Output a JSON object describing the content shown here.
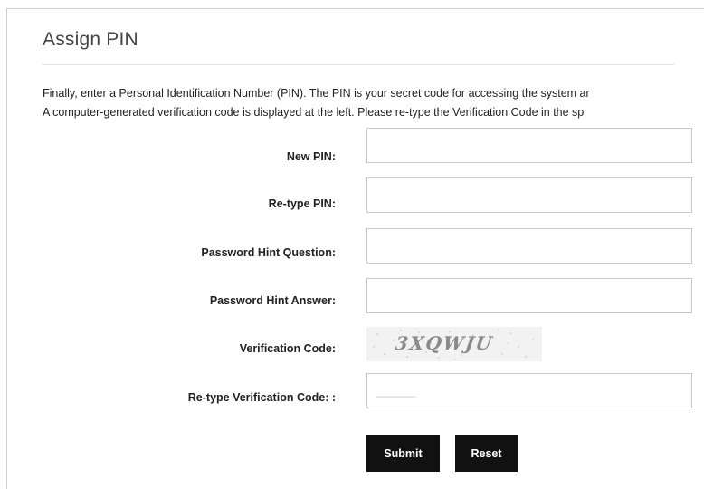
{
  "page": {
    "title": "Assign PIN",
    "intro_line1": "Finally, enter a Personal Identification Number (PIN). The PIN is your secret code for accessing the system ar",
    "intro_line2": "A computer-generated verification code is displayed at the left. Please re-type the Verification Code in the sp"
  },
  "form": {
    "new_pin": {
      "label": "New PIN:",
      "value": "",
      "placeholder": ""
    },
    "retype_pin": {
      "label": "Re-type PIN:",
      "value": "",
      "placeholder": ""
    },
    "hint_question": {
      "label": "Password Hint Question:",
      "value": "",
      "placeholder": ""
    },
    "hint_answer": {
      "label": "Password Hint Answer:",
      "value": "",
      "placeholder": ""
    },
    "verification_code": {
      "label": "Verification Code:",
      "captcha_text": "3XQWJU"
    },
    "retype_verification": {
      "label": "Re-type Verification Code: :",
      "value": "",
      "placeholder": "______"
    }
  },
  "buttons": {
    "submit_label": "Submit",
    "reset_label": "Reset"
  },
  "colors": {
    "button_bg": "#111111",
    "button_text": "#ffffff",
    "input_border": "#c8c8c8",
    "captcha_bg": "#f2f2f2"
  }
}
